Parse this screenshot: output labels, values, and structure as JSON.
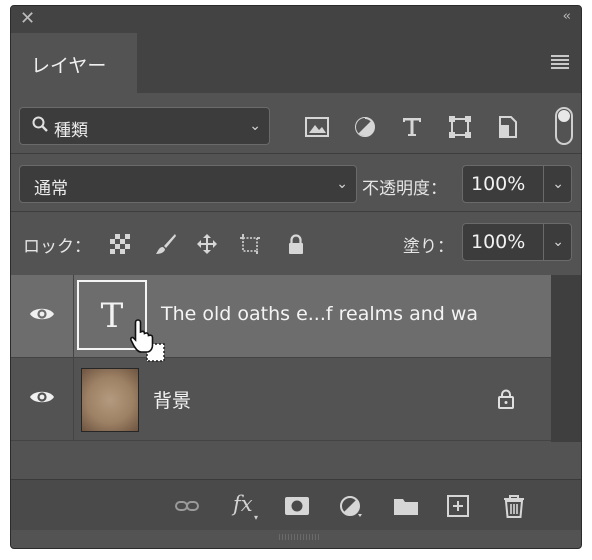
{
  "panel": {
    "close_glyph": "✕",
    "collapse_glyph": "‹‹",
    "tab_label": "レイヤー"
  },
  "filter": {
    "kind_label": "種類",
    "icons": [
      "image-filter-icon",
      "adjustment-filter-icon",
      "type-filter-icon",
      "shape-filter-icon",
      "smart-object-filter-icon"
    ]
  },
  "blend": {
    "mode": "通常",
    "opacity_label": "不透明度：",
    "opacity_value": "100%"
  },
  "lock": {
    "label": "ロック：",
    "fill_label": "塗り：",
    "fill_value": "100%"
  },
  "layers": [
    {
      "name": "The old oaths e...f realms and wa",
      "type": "text",
      "selected": true,
      "visible": true,
      "thumb_glyph": "T"
    },
    {
      "name": "背景",
      "type": "background",
      "selected": false,
      "visible": true,
      "locked": true
    }
  ],
  "bottom": {
    "fx_label": "fx"
  },
  "colors": {
    "panel_bg": "#535353",
    "selected_row": "#6d6d6d",
    "field_bg": "#3c3c3c"
  }
}
